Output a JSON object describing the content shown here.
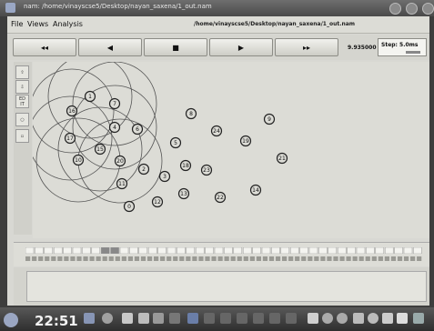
{
  "window": {
    "title": "nam: /home/vinayscse5/Desktop/nayan_saxena/1_out.nam",
    "path": "/home/vinayscse5/Desktop/nayan_saxena/1_out.nam"
  },
  "menu": {
    "file": "File",
    "views": "Views",
    "analysis": "Analysis"
  },
  "toolbar": {
    "rewind": "◂◂",
    "back": "◀",
    "stop": "■",
    "play": "▶",
    "fast_forward": "▸▸",
    "time": "9.935000",
    "step": "Step: 5.0ms"
  },
  "sidebar": {
    "edit": "ED IT"
  },
  "nodes": [
    "0",
    "1",
    "2",
    "3",
    "4",
    "5",
    "6",
    "7",
    "8",
    "9",
    "10",
    "11",
    "12",
    "13",
    "14",
    "15",
    "16",
    "17",
    "18",
    "19",
    "20",
    "21",
    "22",
    "23",
    "24"
  ],
  "clock": "22:51",
  "colors": {
    "node_fill": "#dcdcd6",
    "node_stroke": "#222222",
    "range_circle": "#555555",
    "titlebar": "#5a5a5a",
    "canvas": "#dcdcd6"
  }
}
